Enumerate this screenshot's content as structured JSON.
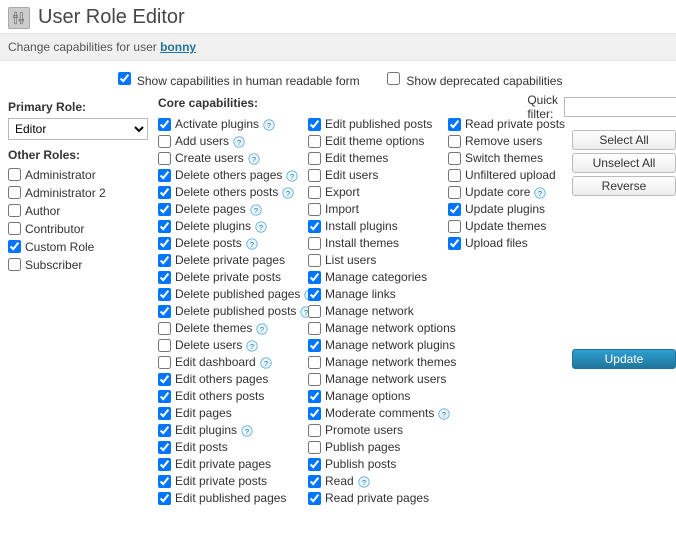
{
  "header": {
    "title": "User Role Editor"
  },
  "subheader": {
    "prefix": "Change capabilities for user ",
    "user": "bonny"
  },
  "toolbar": {
    "human_readable": {
      "label": "Show capabilities in human readable form",
      "checked": true
    },
    "deprecated": {
      "label": "Show deprecated capabilities",
      "checked": false
    }
  },
  "sidebar": {
    "primary_label": "Primary Role:",
    "primary_value": "Editor",
    "other_label": "Other Roles:",
    "other_roles": [
      {
        "label": "Administrator",
        "checked": false
      },
      {
        "label": "Administrator 2",
        "checked": false
      },
      {
        "label": "Author",
        "checked": false
      },
      {
        "label": "Contributor",
        "checked": false
      },
      {
        "label": "Custom Role",
        "checked": true
      },
      {
        "label": "Subscriber",
        "checked": false
      }
    ]
  },
  "caps": {
    "heading": "Core capabilities:",
    "filter_label": "Quick filter:",
    "filter_value": "",
    "col1": [
      {
        "label": "Activate plugins",
        "checked": true,
        "help": true
      },
      {
        "label": "Add users",
        "checked": false,
        "help": true
      },
      {
        "label": "Create users",
        "checked": false,
        "help": true
      },
      {
        "label": "Delete others pages",
        "checked": true,
        "help": true
      },
      {
        "label": "Delete others posts",
        "checked": true,
        "help": true
      },
      {
        "label": "Delete pages",
        "checked": true,
        "help": true
      },
      {
        "label": "Delete plugins",
        "checked": true,
        "help": true
      },
      {
        "label": "Delete posts",
        "checked": true,
        "help": true
      },
      {
        "label": "Delete private pages",
        "checked": true,
        "help": false
      },
      {
        "label": "Delete private posts",
        "checked": true,
        "help": false
      },
      {
        "label": "Delete published pages",
        "checked": true,
        "help": true
      },
      {
        "label": "Delete published posts",
        "checked": true,
        "help": true
      },
      {
        "label": "Delete themes",
        "checked": false,
        "help": true
      },
      {
        "label": "Delete users",
        "checked": false,
        "help": true
      },
      {
        "label": "Edit dashboard",
        "checked": false,
        "help": true
      },
      {
        "label": "Edit others pages",
        "checked": true,
        "help": false
      },
      {
        "label": "Edit others posts",
        "checked": true,
        "help": false
      },
      {
        "label": "Edit pages",
        "checked": true,
        "help": false
      },
      {
        "label": "Edit plugins",
        "checked": true,
        "help": true
      },
      {
        "label": "Edit posts",
        "checked": true,
        "help": false
      },
      {
        "label": "Edit private pages",
        "checked": true,
        "help": false
      },
      {
        "label": "Edit private posts",
        "checked": true,
        "help": false
      },
      {
        "label": "Edit published pages",
        "checked": true,
        "help": false
      }
    ],
    "col2": [
      {
        "label": "Edit published posts",
        "checked": true,
        "help": false
      },
      {
        "label": "Edit theme options",
        "checked": false,
        "help": false
      },
      {
        "label": "Edit themes",
        "checked": false,
        "help": false
      },
      {
        "label": "Edit users",
        "checked": false,
        "help": false
      },
      {
        "label": "Export",
        "checked": false,
        "help": false
      },
      {
        "label": "Import",
        "checked": false,
        "help": false
      },
      {
        "label": "Install plugins",
        "checked": true,
        "help": false
      },
      {
        "label": "Install themes",
        "checked": false,
        "help": false
      },
      {
        "label": "List users",
        "checked": false,
        "help": false
      },
      {
        "label": "Manage categories",
        "checked": true,
        "help": false
      },
      {
        "label": "Manage links",
        "checked": true,
        "help": false
      },
      {
        "label": "Manage network",
        "checked": false,
        "help": false
      },
      {
        "label": "Manage network options",
        "checked": false,
        "help": false
      },
      {
        "label": "Manage network plugins",
        "checked": true,
        "help": false
      },
      {
        "label": "Manage network themes",
        "checked": false,
        "help": false
      },
      {
        "label": "Manage network users",
        "checked": false,
        "help": false
      },
      {
        "label": "Manage options",
        "checked": true,
        "help": false
      },
      {
        "label": "Moderate comments",
        "checked": true,
        "help": true
      },
      {
        "label": "Promote users",
        "checked": false,
        "help": false
      },
      {
        "label": "Publish pages",
        "checked": false,
        "help": false
      },
      {
        "label": "Publish posts",
        "checked": true,
        "help": false
      },
      {
        "label": "Read",
        "checked": true,
        "help": true
      },
      {
        "label": "Read private pages",
        "checked": true,
        "help": false
      }
    ],
    "col3": [
      {
        "label": "Read private posts",
        "checked": true,
        "help": false
      },
      {
        "label": "Remove users",
        "checked": false,
        "help": false
      },
      {
        "label": "Switch themes",
        "checked": false,
        "help": false
      },
      {
        "label": "Unfiltered upload",
        "checked": false,
        "help": false
      },
      {
        "label": "Update core",
        "checked": false,
        "help": true
      },
      {
        "label": "Update plugins",
        "checked": true,
        "help": false
      },
      {
        "label": "Update themes",
        "checked": false,
        "help": false
      },
      {
        "label": "Upload files",
        "checked": true,
        "help": false
      }
    ]
  },
  "buttons": {
    "select_all": "Select All",
    "unselect_all": "Unselect All",
    "reverse": "Reverse",
    "update": "Update"
  }
}
